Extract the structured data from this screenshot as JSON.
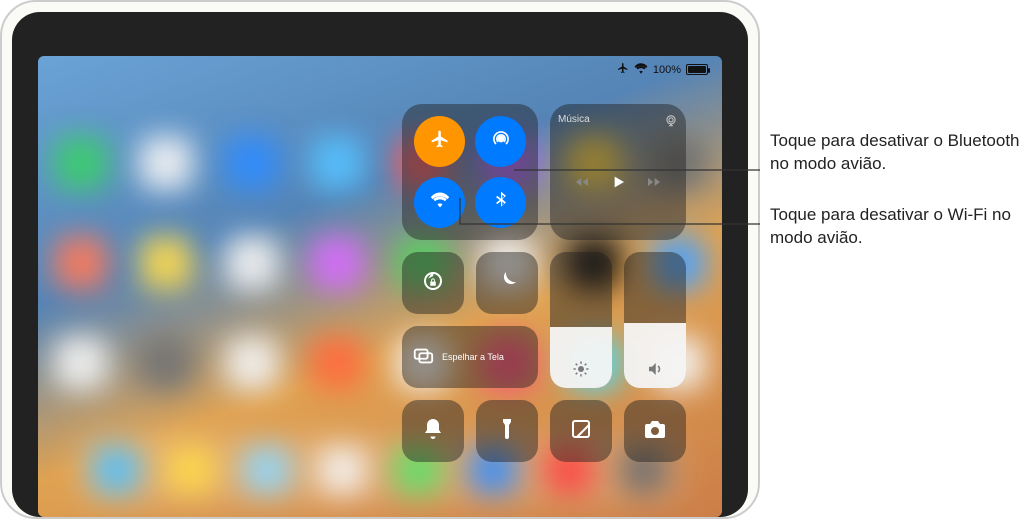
{
  "status": {
    "battery_pct": "100%"
  },
  "callouts": {
    "bluetooth": "Toque para desativar o Bluetooth no modo avião.",
    "wifi": "Toque para desativar o Wi-Fi no modo avião."
  },
  "control_center": {
    "music": {
      "title": "Música"
    },
    "mirror": {
      "label": "Espelhar a Tela"
    },
    "brightness_level": 0.45,
    "volume_level": 0.48
  },
  "icons": {
    "airplane": "airplane-icon",
    "airdrop": "airdrop-icon",
    "wifi": "wifi-icon",
    "bluetooth": "bluetooth-icon",
    "airplay_audio": "airplay-audio-icon",
    "rewind": "rewind-icon",
    "play": "play-icon",
    "forward": "forward-icon",
    "rotation_lock": "rotation-lock-icon",
    "dnd": "moon-icon",
    "screen_mirror": "screen-mirror-icon",
    "brightness": "brightness-icon",
    "volume": "volume-icon",
    "silent": "bell-icon",
    "flashlight": "flashlight-icon",
    "note": "note-icon",
    "camera": "camera-icon"
  },
  "colors": {
    "orange": "#ff9500",
    "blue": "#007aff",
    "tile": "rgba(30,30,30,0.45)"
  }
}
